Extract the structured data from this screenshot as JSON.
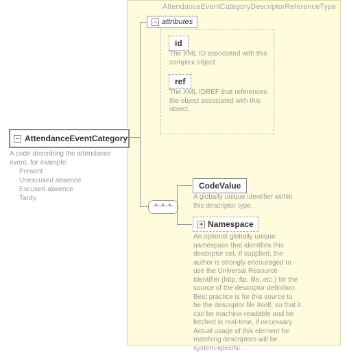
{
  "panel": {
    "title": "AttendanceEventCategoryDescriptorReferenceType"
  },
  "root": {
    "name": "AttendanceEventCategory",
    "desc_line1": "A code describing the attendance event, for example:",
    "examples": [
      "Present",
      "Unexcused absence",
      "Excused absence",
      "Tardy."
    ]
  },
  "attributes": {
    "header": "attributes",
    "id": {
      "name": "id",
      "desc": "The XML ID associated with this complex object."
    },
    "ref": {
      "name": "ref",
      "desc": "The XML IDREF that references the object associated with this object."
    }
  },
  "children": {
    "codeValue": {
      "name": "CodeValue",
      "desc": "A globally unique identifier within this descriptor type."
    },
    "namespace": {
      "name": "Namespace",
      "desc": "An optional globally unique namespace that identifies this descriptor set. If supplied, the author is strongly encouraged to use the Universal Resource Identifier (http, ftp, file, etc.) for the source of the descriptor definition. Best practice is for this source to be the descriptor file itself, so that it can be machine-readable and be fetched in real-time, if necessary. Actual usage of this element for matching descriptors will be system-specific."
    }
  }
}
